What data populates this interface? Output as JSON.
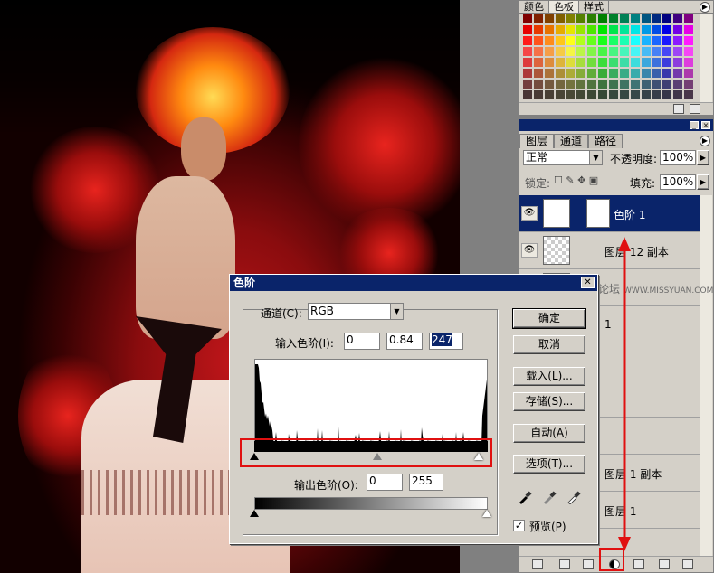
{
  "swatches_panel": {
    "tabs": [
      "颜色",
      "色板",
      "样式"
    ],
    "active_tab": "色板",
    "colors": [
      "#ff0000",
      "#ff8000",
      "#ffff00",
      "#80ff00",
      "#00ff00",
      "#00ff80",
      "#00ffff",
      "#0080ff",
      "#0000ff",
      "#8000ff",
      "#ff00ff",
      "#ff0080",
      "#800000",
      "#808000",
      "#008000",
      "#008080"
    ]
  },
  "layers_panel": {
    "tabs": [
      "图层",
      "通道",
      "路径"
    ],
    "active_tab": "图层",
    "blend_mode": "正常",
    "opacity_label": "不透明度:",
    "opacity_value": "100%",
    "lock_label": "锁定:",
    "fill_label": "填充:",
    "fill_value": "100%",
    "layers": [
      {
        "name": "色阶 1",
        "selected": true,
        "visible": true
      },
      {
        "name": "图层 12 副本",
        "selected": false,
        "visible": true
      },
      {
        "name": "",
        "selected": false,
        "visible": false
      },
      {
        "name": "1",
        "selected": false,
        "visible": false
      },
      {
        "name": "",
        "selected": false,
        "visible": false
      },
      {
        "name": "",
        "selected": false,
        "visible": false
      },
      {
        "name": "",
        "selected": false,
        "visible": false
      },
      {
        "name": "图层 1 副本",
        "selected": false,
        "visible": false
      },
      {
        "name": "图层 1",
        "selected": false,
        "visible": false
      }
    ]
  },
  "levels_dialog": {
    "title": "色阶",
    "channel_label": "通道(C):",
    "channel_value": "RGB",
    "input_label": "输入色阶(I):",
    "input_black": "0",
    "input_gamma": "0.84",
    "input_white": "247",
    "output_label": "输出色阶(O):",
    "output_black": "0",
    "output_white": "255",
    "buttons": {
      "ok": "确定",
      "cancel": "取消",
      "load": "载入(L)...",
      "save": "存储(S)...",
      "auto": "自动(A)",
      "options": "选项(T)..."
    },
    "preview_label": "预览(P)",
    "preview_checked": true
  },
  "watermark": {
    "text": "思缘设计论坛",
    "url": "WWW.MISSYUAN.COM"
  }
}
